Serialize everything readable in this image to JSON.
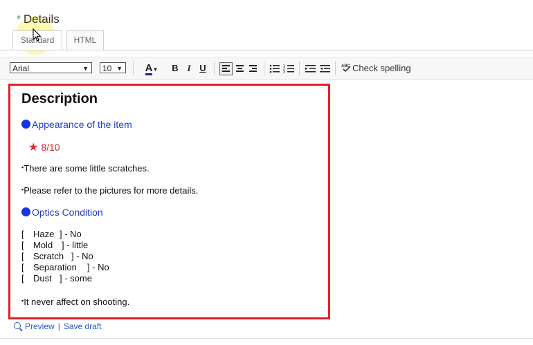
{
  "details": {
    "required_mark": "*",
    "title": "Details"
  },
  "tabs": [
    {
      "label": "Standard"
    },
    {
      "label": "HTML"
    }
  ],
  "toolbar": {
    "font_value": "Arial",
    "size_value": "10",
    "bold": "B",
    "italic": "I",
    "underline": "U",
    "text_color": "A",
    "spell_check_label": "Check spelling"
  },
  "content": {
    "title": "Description",
    "appearance_heading": "Appearance of the item",
    "rating": "8/10",
    "bullet1": "There are some little scratches.",
    "bullet2": "Please refer to the pictures for more details.",
    "optics_heading": "Optics Condition",
    "conditions": [
      {
        "name": "Haze",
        "value": "No"
      },
      {
        "name": "Mold",
        "value": "little"
      },
      {
        "name": "Scratch",
        "value": "No"
      },
      {
        "name": "Separation",
        "value": "No"
      },
      {
        "name": "Dust",
        "value": "some"
      }
    ],
    "bullet3": "It never affect on shooting."
  },
  "footer": {
    "preview": "Preview",
    "save_draft": "Save draft"
  },
  "colors": {
    "highlight_border": "#e41e26",
    "heading_blue": "#1f3cc8",
    "rating_red": "#e0262a",
    "link_blue": "#2a5bbd"
  }
}
